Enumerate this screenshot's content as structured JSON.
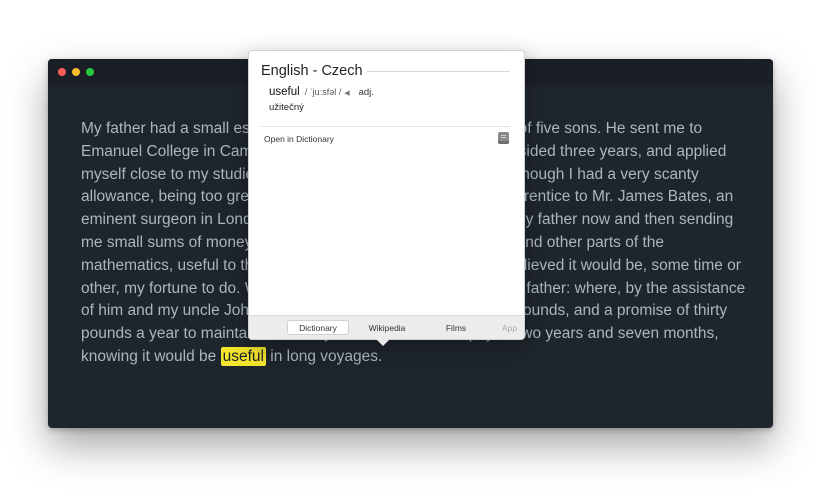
{
  "window": {
    "controls": [
      "close",
      "minimize",
      "maximize"
    ]
  },
  "passage": {
    "before_word": "My father had a small estate in Nottinghamshire; I was the third of five sons. He sent me to Emanuel College in Cambridge at fourteen years old, where I resided three years, and applied myself close to my studies; but the charge of maintaining me, although I had a very scanty allowance, being too great for a narrow fortune, I was bound apprentice to Mr. James Bates, an eminent surgeon in London, with whom I continued four years. My father now and then sending me small sums of money, I laid them out in learning navigation, and other parts of the mathematics, useful to those who intend to travel, as I always believed it would be, some time or other, my fortune to do. When I left Mr. Bates, I went down to my father: where, by the assistance of him and my uncle John, and some other relations, I got forty pounds, and a promise of thirty pounds a year to maintain me at Leyden: there I studied physic two years and seven months, knowing it would be ",
    "highlighted_word": "useful",
    "after_word": " in long voyages."
  },
  "popover": {
    "title": "English - Czech",
    "entry": {
      "word": "useful",
      "pronunciation": "/ ˈjuːsfəl /",
      "audio_icon": "speaker-icon",
      "audio_glyph": "◀",
      "part_of_speech": "adj.",
      "translation": "užitečný"
    },
    "open_link": "Open in Dictionary",
    "dictionary_icon": "dictionary-app-icon",
    "tabs": [
      {
        "label": "Dictionary",
        "active": true
      },
      {
        "label": "Wikipedia",
        "active": false
      },
      {
        "label": "Films",
        "active": false
      },
      {
        "label": "App",
        "active": false
      }
    ]
  },
  "colors": {
    "window_bg": "#1f252d",
    "text": "#aeb5bd",
    "highlight": "#f5e52e",
    "close": "#fc5e57",
    "minimize": "#fdbc2e",
    "maximize": "#28c840"
  }
}
